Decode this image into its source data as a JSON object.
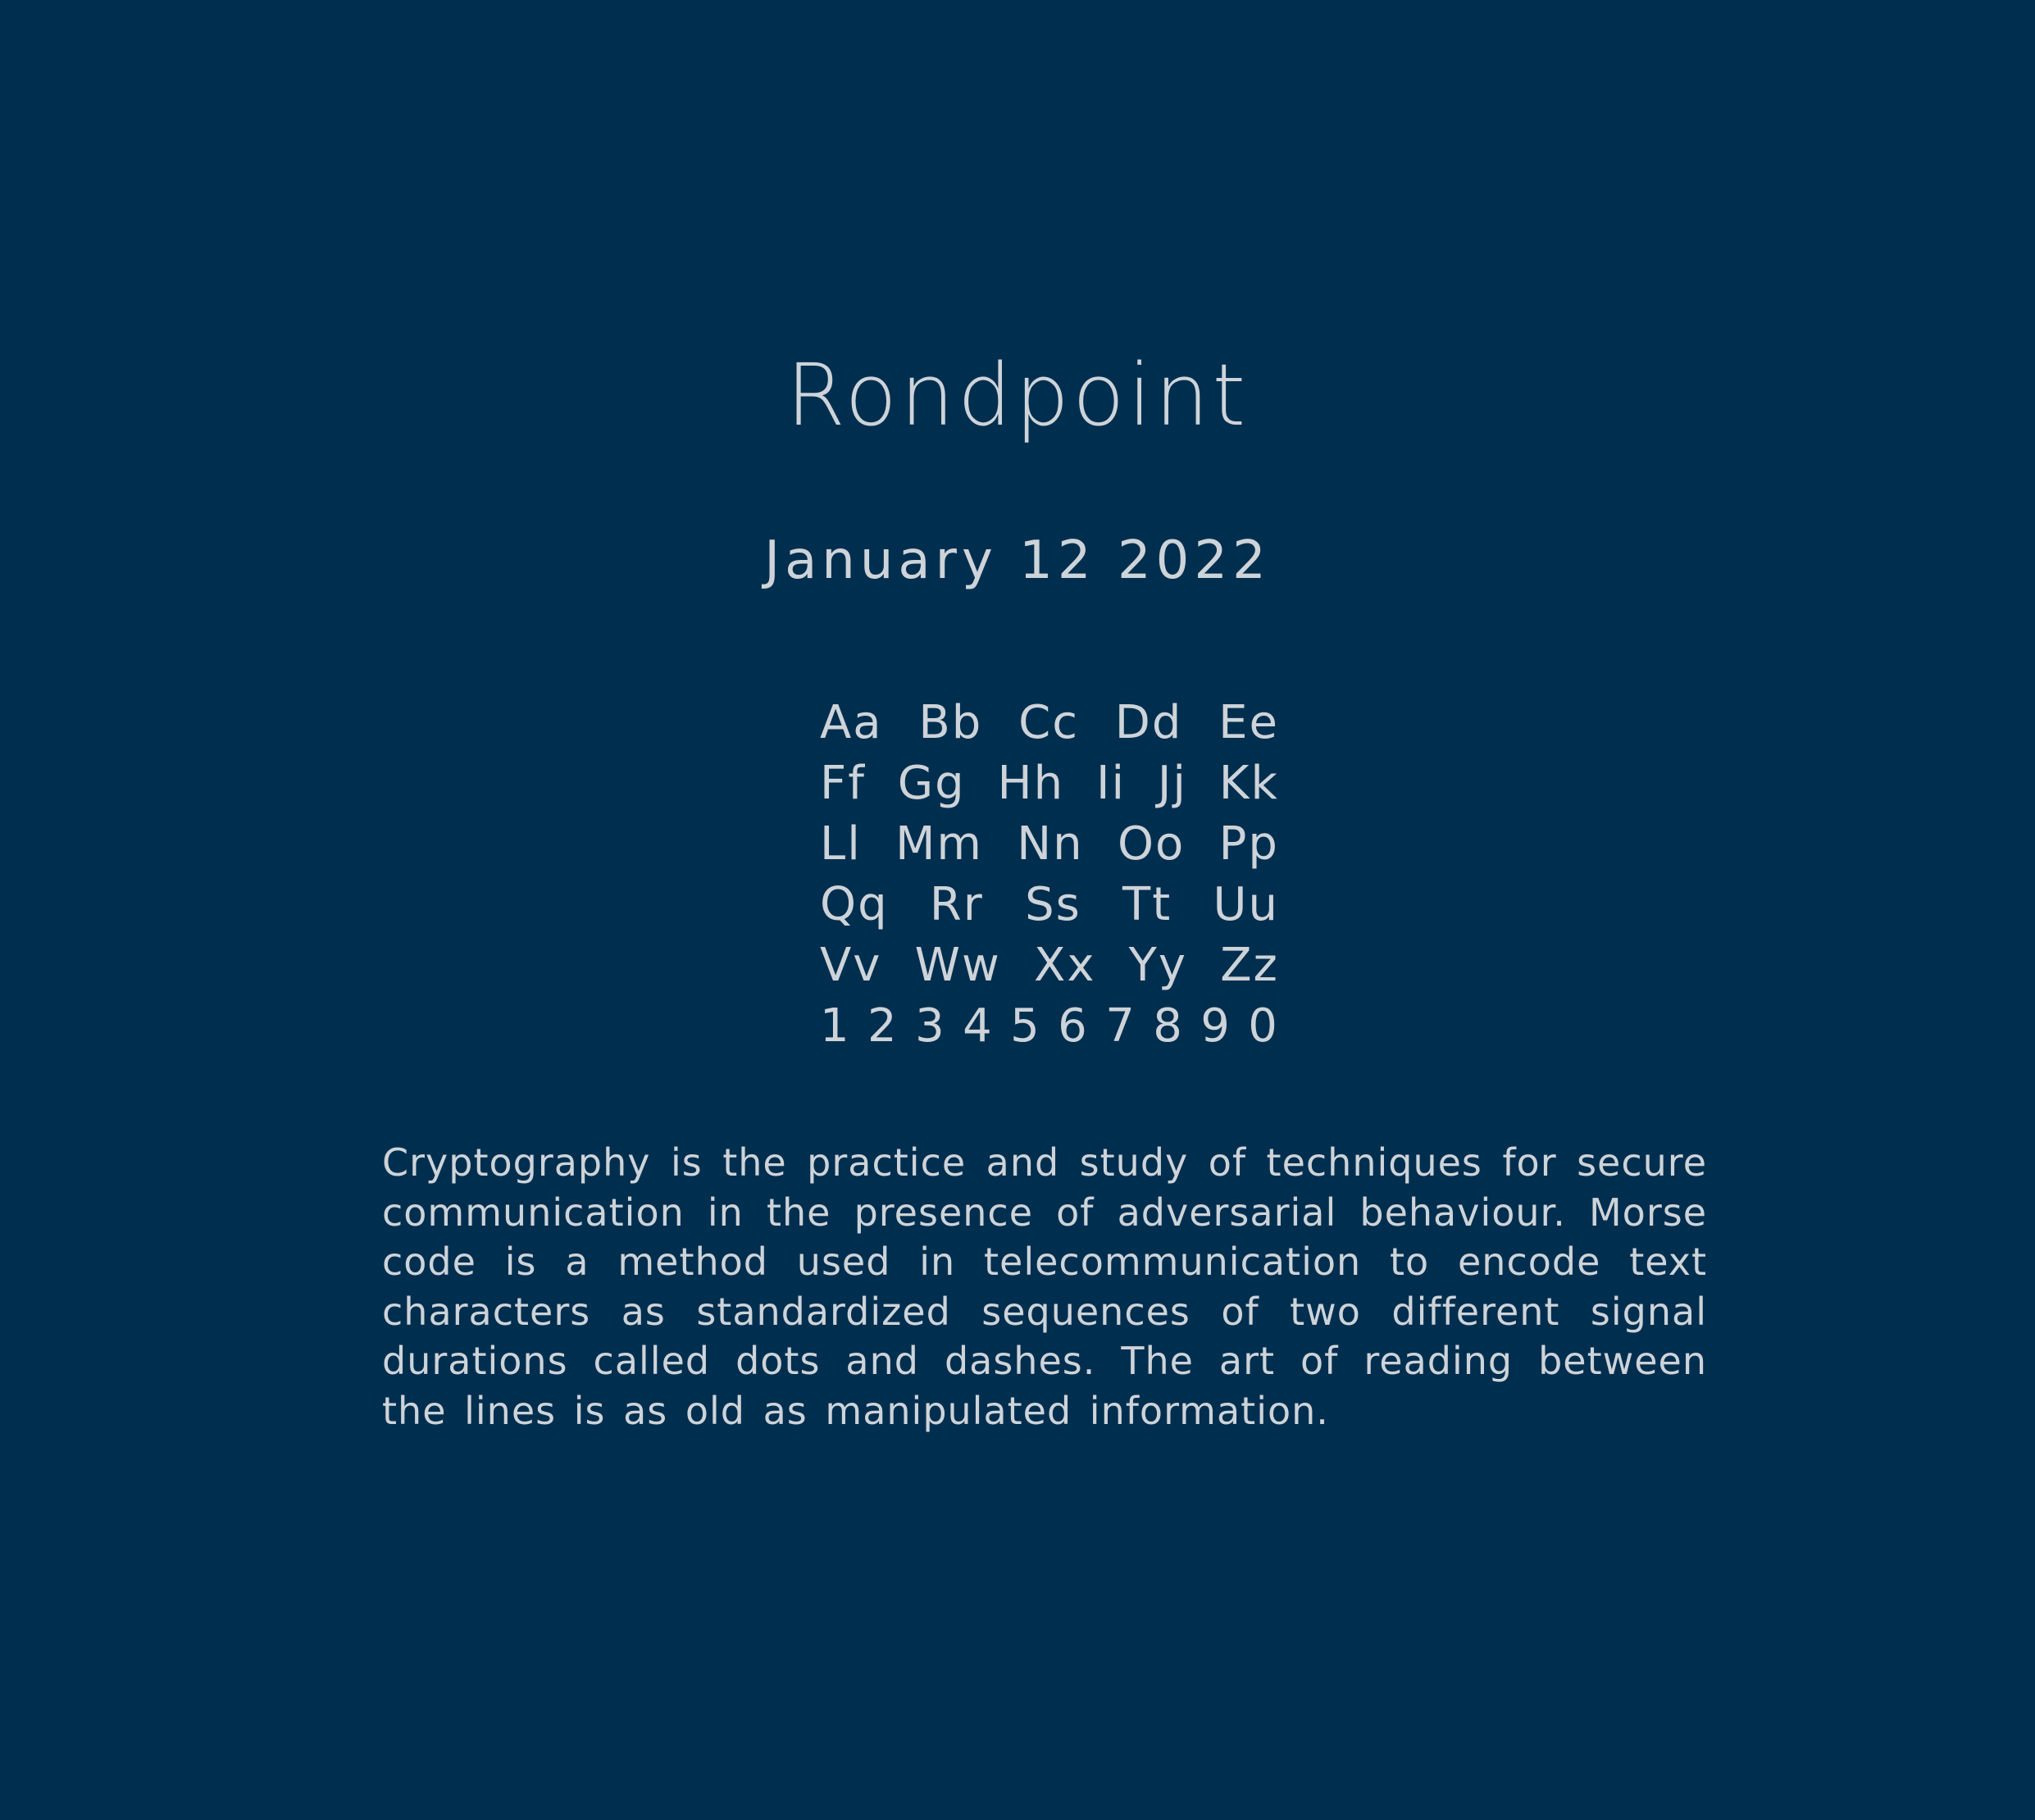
{
  "title": "Rondpoint",
  "date": "January 12 2022",
  "specimen_rows": [
    [
      "Aa",
      "Bb",
      "Cc",
      "Dd",
      "Ee"
    ],
    [
      "Ff",
      "Gg",
      "Hh",
      "Ii",
      "Jj",
      "Kk"
    ],
    [
      "Ll",
      "Mm",
      "Nn",
      "Oo",
      "Pp"
    ],
    [
      "Qq",
      "Rr",
      "Ss",
      "Tt",
      "Uu"
    ],
    [
      "Vv",
      "Ww",
      "Xx",
      "Yy",
      "Zz"
    ],
    [
      "1",
      "2",
      "3",
      "4",
      "5",
      "6",
      "7",
      "8",
      "9",
      "0"
    ]
  ],
  "body_text": "Cryptography is the practice and study of techniques for secure communication in the presence of adversarial behaviour. Morse code is a method used in telecommunication to encode text characters as standardized sequences of two different signal durations called dots and dashes. The art of reading between the lines is as old as manipulated information.",
  "colors": {
    "background": "#002e4f",
    "text": "#cdd3d8"
  }
}
